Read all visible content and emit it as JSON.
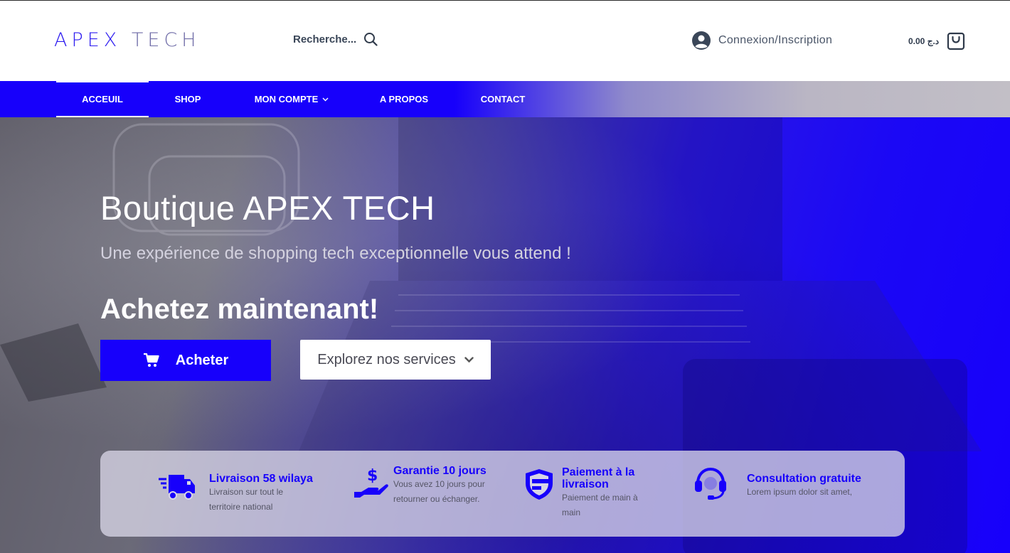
{
  "header": {
    "logo_part1": "APEX",
    "logo_part2": "TECH",
    "search_label": "Recherche...",
    "account_label": "Connexion/Inscription",
    "cart_total": "0.00 د.ج"
  },
  "nav": {
    "items": [
      {
        "label": "ACCEUIL"
      },
      {
        "label": "SHOP"
      },
      {
        "label": "MON COMPTE"
      },
      {
        "label": "A PROPOS"
      },
      {
        "label": "CONTACT"
      }
    ]
  },
  "hero": {
    "title": "Boutique APEX TECH",
    "subtitle": "Une expérience de shopping tech exceptionnelle vous attend !",
    "cta_title": "Achetez maintenant!",
    "buy_button": "Acheter",
    "explore_button": "Explorez nos services"
  },
  "features": [
    {
      "icon": "truck-icon",
      "title": "Livraison 58 wilaya",
      "desc": "Livraison sur tout le territoire national"
    },
    {
      "icon": "hand-dollar-icon",
      "title": "Garantie 10 jours",
      "desc": "Vous avez 10 jours pour retourner ou échanger."
    },
    {
      "icon": "card-shield-icon",
      "title": "Paiement à la livraison",
      "desc": "Paiement de main à main"
    },
    {
      "icon": "headset-icon",
      "title": "Consultation gratuite",
      "desc": "Lorem ipsum dolor sit amet,"
    }
  ],
  "colors": {
    "brand_blue": "#1700fb",
    "nav_text": "#ffffff",
    "feature_title": "#1700fb"
  }
}
